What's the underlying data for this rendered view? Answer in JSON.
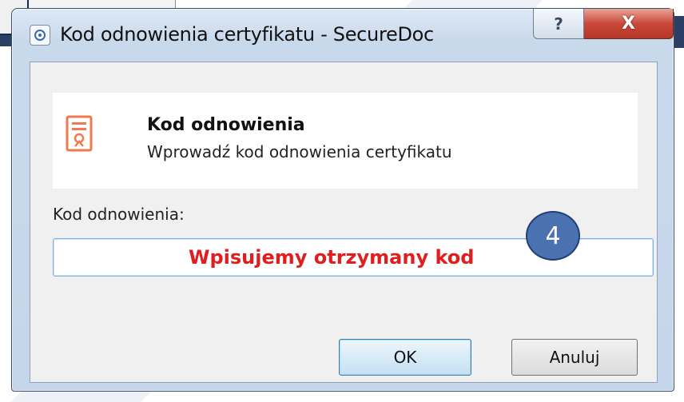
{
  "window": {
    "title": "Kod odnowienia certyfikatu - SecureDoc",
    "help_glyph": "?",
    "close_glyph": "X"
  },
  "header": {
    "title": "Kod odnowienia",
    "subtitle": "Wprowadź kod odnowienia certyfikatu",
    "icon": "certificate-icon",
    "icon_color": "#f07a4d"
  },
  "form": {
    "label": "Kod odnowienia:",
    "input_value": ""
  },
  "annotation": {
    "text": "Wpisujemy otrzymany kod",
    "step": "4",
    "text_color": "#e11d1d",
    "badge_color": "#4a72b0"
  },
  "buttons": {
    "ok_label": "OK",
    "cancel_label": "Anuluj"
  }
}
